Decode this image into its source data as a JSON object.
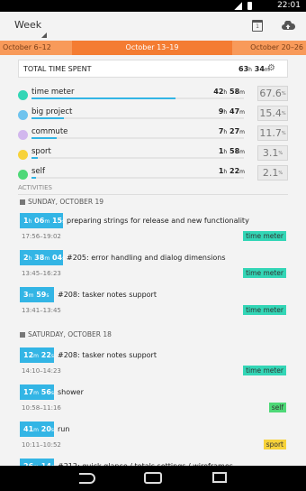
{
  "status": {
    "time": "22:01"
  },
  "appbar": {
    "period": "Week"
  },
  "weeks": {
    "prev": "October 6–12",
    "current": "October 13–19",
    "next": "October 20–26"
  },
  "total": {
    "label": "TOTAL TIME SPENT",
    "h": "63",
    "m": "34"
  },
  "tags": [
    {
      "name": "time meter",
      "h": "42",
      "m": "58",
      "pct": "67.6",
      "color": "#33d6b6",
      "fraction": 0.676
    },
    {
      "name": "big project",
      "h": "9",
      "m": "47",
      "pct": "15.4",
      "color": "#6ec3ee",
      "fraction": 0.154
    },
    {
      "name": "commute",
      "h": "7",
      "m": "27",
      "pct": "11.7",
      "color": "#d2b7ee",
      "fraction": 0.117
    },
    {
      "name": "sport",
      "h": "1",
      "m": "58",
      "pct": "3.1",
      "color": "#f7d23a",
      "fraction": 0.031
    },
    {
      "name": "self",
      "h": "1",
      "m": "22",
      "pct": "2.1",
      "color": "#4ed877",
      "fraction": 0.021
    }
  ],
  "activities_header": "ACTIVITIES",
  "days": [
    {
      "label": "SUNDAY, OCTOBER 19"
    },
    {
      "label": "SATURDAY, OCTOBER 18"
    }
  ],
  "activities": [
    {
      "h": "1",
      "m": "06",
      "s": "15",
      "desc": "preparing strings for release and new functionality",
      "time": "17:56–19:02",
      "tag": "time meter",
      "tag_color": "#33d6b6"
    },
    {
      "h": "2",
      "m": "38",
      "s": "04",
      "desc": "#205: error handling and dialog dimensions",
      "time": "13:45–16:23",
      "tag": "time meter",
      "tag_color": "#33d6b6"
    },
    {
      "h": "3",
      "m": "59",
      "s": "",
      "desc": "#208: tasker notes support",
      "time": "13:41–13:45",
      "tag": "time meter",
      "tag_color": "#33d6b6"
    },
    {
      "h": "12",
      "m": "22",
      "s": "",
      "desc": "#208: tasker notes support",
      "time": "14:10–14:23",
      "tag": "time meter",
      "tag_color": "#33d6b6"
    },
    {
      "h": "17",
      "m": "56",
      "s": "",
      "desc": "shower",
      "time": "10:58–11:16",
      "tag": "self",
      "tag_color": "#4ed877"
    },
    {
      "h": "41",
      "m": "20",
      "s": "",
      "desc": "run",
      "time": "10:11–10:52",
      "tag": "sport",
      "tag_color": "#f7d23a"
    },
    {
      "h": "26",
      "m": "14",
      "s": "",
      "desc": "#212: quick glance / totals settings / wireframes",
      "time": "",
      "tag": "",
      "tag_color": ""
    }
  ]
}
